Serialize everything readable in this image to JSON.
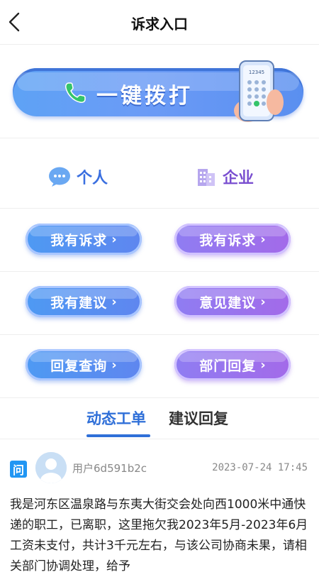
{
  "header": {
    "title": "诉求入口"
  },
  "banner": {
    "call_label": "一键拨打",
    "phone_screen_number": "12345"
  },
  "sections": {
    "personal": "个人",
    "business": "企业"
  },
  "buttons": {
    "row1": {
      "left": "我有诉求",
      "right": "我有诉求"
    },
    "row2": {
      "left": "我有建议",
      "right": "意见建议"
    },
    "row3": {
      "left": "回复查询",
      "right": "部门回复"
    },
    "chevron": "›"
  },
  "feed_tabs": {
    "active": "动态工单",
    "inactive": "建议回复"
  },
  "post": {
    "badge": "问",
    "username": "用户6d591b2c",
    "time": "2023-07-24  17:45",
    "body": "我是河东区温泉路与东夷大街交会处向西1000米中通快递的职工，已离职，这里拖欠我2023年5月-2023年6月工资未支付，共计3千元左右，与该公司协商未果，请相关部门协调处理，给予"
  },
  "colors": {
    "blue_accent": "#2f6fd8",
    "purple_accent": "#7a4fd0",
    "badge_blue": "#2196f3"
  }
}
